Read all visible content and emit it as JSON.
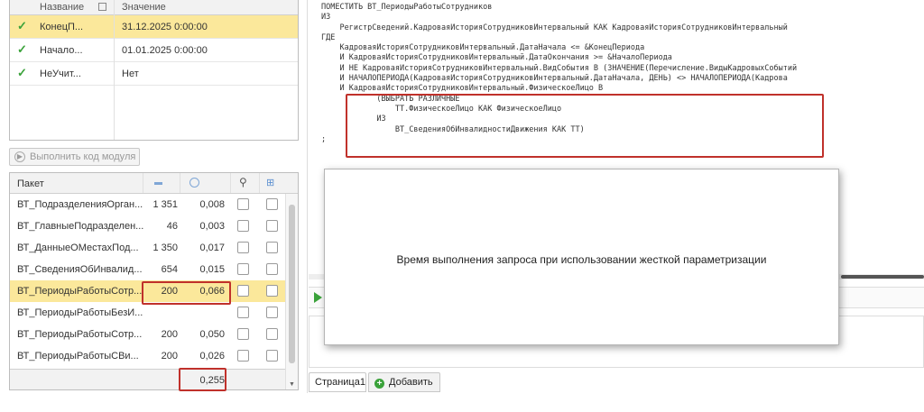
{
  "params": {
    "col_name": "Название",
    "col_value": "Значение",
    "rows": [
      {
        "name": "КонецП...",
        "value": "31.12.2025 0:00:00"
      },
      {
        "name": "Начало...",
        "value": "01.01.2025 0:00:00"
      },
      {
        "name": "НеУчит...",
        "value": "Нет"
      }
    ]
  },
  "run_button": "Выполнить код модуля",
  "packets": {
    "col_name": "Пакет",
    "rows": [
      {
        "name": "ВТ_ПодразделенияОрган...",
        "count": "1 351",
        "time": "0,008"
      },
      {
        "name": "ВТ_ГлавныеПодразделен...",
        "count": "46",
        "time": "0,003"
      },
      {
        "name": "ВТ_ДанныеОМестахПод...",
        "count": "1 350",
        "time": "0,017"
      },
      {
        "name": "ВТ_СведенияОбИнвалид...",
        "count": "654",
        "time": "0,015"
      },
      {
        "name": "ВТ_ПериодыРаботыСотр...",
        "count": "200",
        "time": "0,066"
      },
      {
        "name": "ВТ_ПериодыРаботыБезИ...",
        "count": "",
        "time": ""
      },
      {
        "name": "ВТ_ПериодыРаботыСотр...",
        "count": "200",
        "time": "0,050"
      },
      {
        "name": "ВТ_ПериодыРаботыСВи...",
        "count": "200",
        "time": "0,026"
      }
    ],
    "total_time": "0,255"
  },
  "code": {
    "lines": [
      "ПОМЕСТИТЬ ВТ_ПериодыРаботыСотрудников",
      "ИЗ",
      "    РегистрСведений.КадроваяИсторияСотрудниковИнтервальный КАК КадроваяИсторияСотрудниковИнтервальный",
      "ГДЕ",
      "    КадроваяИсторияСотрудниковИнтервальный.ДатаНачала <= &КонецПериода",
      "    И КадроваяИсторияСотрудниковИнтервальный.ДатаОкончания >= &НачалоПериода",
      "    И НЕ КадроваяИсторияСотрудниковИнтервальный.ВидСобытия В (ЗНАЧЕНИЕ(Перечисление.ВидыКадровыхСобытий",
      "    И НАЧАЛОПЕРИОДА(КадроваяИсторияСотрудниковИнтервальный.ДатаНачала, ДЕНЬ) <> НАЧАЛОПЕРИОДА(Кадрова",
      "    И КадроваяИсторияСотрудниковИнтервальный.ФизическоеЛицо В",
      "            (ВЫБРАТЬ РАЗЛИЧНЫЕ",
      "                ТТ.ФизическоеЛицо КАК ФизическоеЛицо",
      "            ИЗ",
      "                ВТ_СведенияОбИнвалидностиДвижения КАК ТТ)",
      ";"
    ]
  },
  "popup_message": "Время выполнения запроса при использовании жесткой параметризации",
  "tabs": {
    "page": "Страница1",
    "add": "Добавить"
  },
  "colors": {
    "selected_row": "#fbe89b",
    "highlight": "#c0312b",
    "accent": "#3aa23a"
  }
}
